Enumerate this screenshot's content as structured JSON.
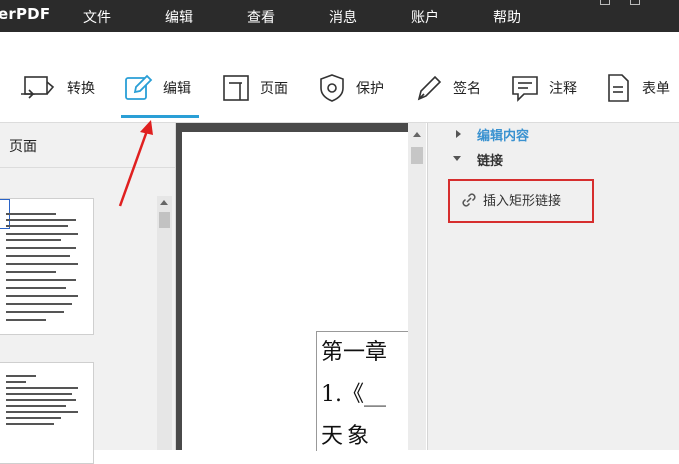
{
  "app": {
    "title": "erPDF"
  },
  "menu": {
    "items": [
      "文件",
      "编辑",
      "查看",
      "消息",
      "账户",
      "帮助"
    ]
  },
  "toolbar": {
    "items": [
      {
        "label": "转换",
        "icon": "convert-icon"
      },
      {
        "label": "编辑",
        "icon": "edit-pencil-icon",
        "active": true
      },
      {
        "label": "页面",
        "icon": "page-icon"
      },
      {
        "label": "保护",
        "icon": "shield-icon"
      },
      {
        "label": "签名",
        "icon": "sign-pen-icon"
      },
      {
        "label": "注释",
        "icon": "comment-icon"
      },
      {
        "label": "表单",
        "icon": "form-icon"
      }
    ],
    "accent_color": "#2a9fd6"
  },
  "left_panel": {
    "title": "页面"
  },
  "document": {
    "lines": [
      "第一章",
      "1.《__",
      "天象"
    ]
  },
  "right_panel": {
    "section_edit": "编辑内容",
    "section_link": "链接",
    "insert_link_label": "插入矩形链接",
    "highlight_color": "#d62e2e"
  }
}
